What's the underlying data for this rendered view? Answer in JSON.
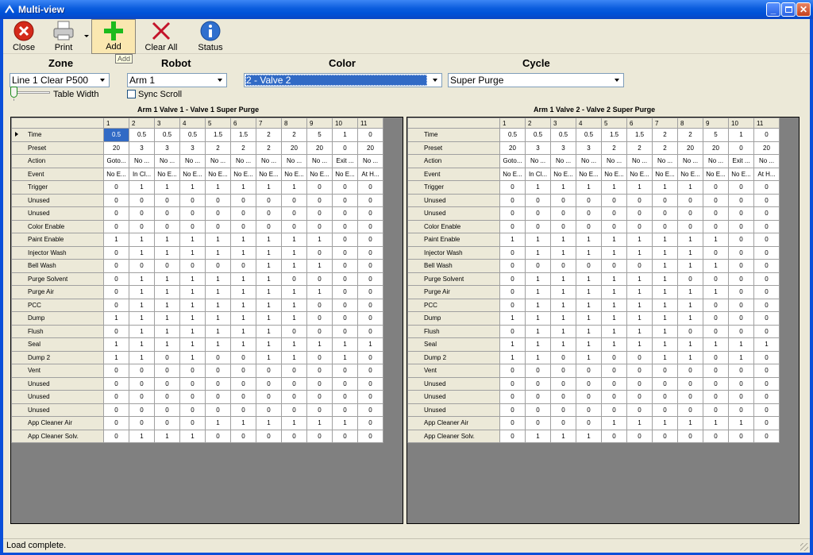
{
  "window": {
    "title": "Multi-view"
  },
  "toolbar": {
    "close_label": "Close",
    "print_label": "Print",
    "add_label": "Add",
    "clear_all_label": "Clear All",
    "status_label": "Status",
    "tooltip": "Add"
  },
  "selectors": {
    "zone": {
      "header": "Zone",
      "value": "Line 1 Clear P500"
    },
    "robot": {
      "header": "Robot",
      "value": "Arm 1"
    },
    "color": {
      "header": "Color",
      "value": "2 - Valve 2"
    },
    "cycle": {
      "header": "Cycle",
      "value": "Super Purge"
    }
  },
  "table_width_label": "Table Width",
  "sync_scroll_label": "Sync Scroll",
  "grids": [
    {
      "caption": "Arm 1  Valve 1 - Valve 1  Super Purge"
    },
    {
      "caption": "Arm 1  Valve 2 - Valve 2  Super Purge"
    }
  ],
  "columns": [
    "1",
    "2",
    "3",
    "4",
    "5",
    "6",
    "7",
    "8",
    "9",
    "10",
    "11"
  ],
  "rows": [
    {
      "label": "Time",
      "values": [
        "0.5",
        "0.5",
        "0.5",
        "0.5",
        "1.5",
        "1.5",
        "2",
        "2",
        "5",
        "1",
        "0"
      ]
    },
    {
      "label": "Preset",
      "values": [
        "20",
        "3",
        "3",
        "3",
        "2",
        "2",
        "2",
        "20",
        "20",
        "0",
        "20"
      ]
    },
    {
      "label": "Action",
      "values": [
        "Goto...",
        "No ...",
        "No ...",
        "No ...",
        "No ...",
        "No ...",
        "No ...",
        "No ...",
        "No ...",
        "Exit ...",
        "No ..."
      ]
    },
    {
      "label": "Event",
      "values": [
        "No E...",
        "In Cl...",
        "No E...",
        "No E...",
        "No E...",
        "No E...",
        "No E...",
        "No E...",
        "No E...",
        "No E...",
        "At H..."
      ]
    },
    {
      "label": "Trigger",
      "values": [
        "0",
        "1",
        "1",
        "1",
        "1",
        "1",
        "1",
        "1",
        "0",
        "0",
        "0"
      ]
    },
    {
      "label": "Unused",
      "values": [
        "0",
        "0",
        "0",
        "0",
        "0",
        "0",
        "0",
        "0",
        "0",
        "0",
        "0"
      ]
    },
    {
      "label": "Unused",
      "values": [
        "0",
        "0",
        "0",
        "0",
        "0",
        "0",
        "0",
        "0",
        "0",
        "0",
        "0"
      ]
    },
    {
      "label": "Color Enable",
      "values": [
        "0",
        "0",
        "0",
        "0",
        "0",
        "0",
        "0",
        "0",
        "0",
        "0",
        "0"
      ]
    },
    {
      "label": "Paint Enable",
      "values": [
        "1",
        "1",
        "1",
        "1",
        "1",
        "1",
        "1",
        "1",
        "1",
        "0",
        "0"
      ]
    },
    {
      "label": "Injector Wash",
      "values": [
        "0",
        "1",
        "1",
        "1",
        "1",
        "1",
        "1",
        "1",
        "0",
        "0",
        "0"
      ]
    },
    {
      "label": "Bell Wash",
      "values": [
        "0",
        "0",
        "0",
        "0",
        "0",
        "0",
        "1",
        "1",
        "1",
        "0",
        "0"
      ]
    },
    {
      "label": "Purge Solvent",
      "values": [
        "0",
        "1",
        "1",
        "1",
        "1",
        "1",
        "1",
        "0",
        "0",
        "0",
        "0"
      ]
    },
    {
      "label": "Purge Air",
      "values": [
        "0",
        "1",
        "1",
        "1",
        "1",
        "1",
        "1",
        "1",
        "1",
        "0",
        "0"
      ]
    },
    {
      "label": "PCC",
      "values": [
        "0",
        "1",
        "1",
        "1",
        "1",
        "1",
        "1",
        "1",
        "0",
        "0",
        "0"
      ]
    },
    {
      "label": "Dump",
      "values": [
        "1",
        "1",
        "1",
        "1",
        "1",
        "1",
        "1",
        "1",
        "0",
        "0",
        "0"
      ]
    },
    {
      "label": "Flush",
      "values": [
        "0",
        "1",
        "1",
        "1",
        "1",
        "1",
        "1",
        "0",
        "0",
        "0",
        "0"
      ]
    },
    {
      "label": "Seal",
      "values": [
        "1",
        "1",
        "1",
        "1",
        "1",
        "1",
        "1",
        "1",
        "1",
        "1",
        "1"
      ]
    },
    {
      "label": "Dump 2",
      "values": [
        "1",
        "1",
        "0",
        "1",
        "0",
        "0",
        "1",
        "1",
        "0",
        "1",
        "0"
      ]
    },
    {
      "label": "Vent",
      "values": [
        "0",
        "0",
        "0",
        "0",
        "0",
        "0",
        "0",
        "0",
        "0",
        "0",
        "0"
      ]
    },
    {
      "label": "Unused",
      "values": [
        "0",
        "0",
        "0",
        "0",
        "0",
        "0",
        "0",
        "0",
        "0",
        "0",
        "0"
      ]
    },
    {
      "label": "Unused",
      "values": [
        "0",
        "0",
        "0",
        "0",
        "0",
        "0",
        "0",
        "0",
        "0",
        "0",
        "0"
      ]
    },
    {
      "label": "Unused",
      "values": [
        "0",
        "0",
        "0",
        "0",
        "0",
        "0",
        "0",
        "0",
        "0",
        "0",
        "0"
      ]
    },
    {
      "label": "App Cleaner Air",
      "values": [
        "0",
        "0",
        "0",
        "0",
        "1",
        "1",
        "1",
        "1",
        "1",
        "1",
        "0"
      ]
    },
    {
      "label": "App Cleaner Solv.",
      "values": [
        "0",
        "1",
        "1",
        "1",
        "0",
        "0",
        "0",
        "0",
        "0",
        "0",
        "0"
      ]
    }
  ],
  "status_text": "Load complete."
}
